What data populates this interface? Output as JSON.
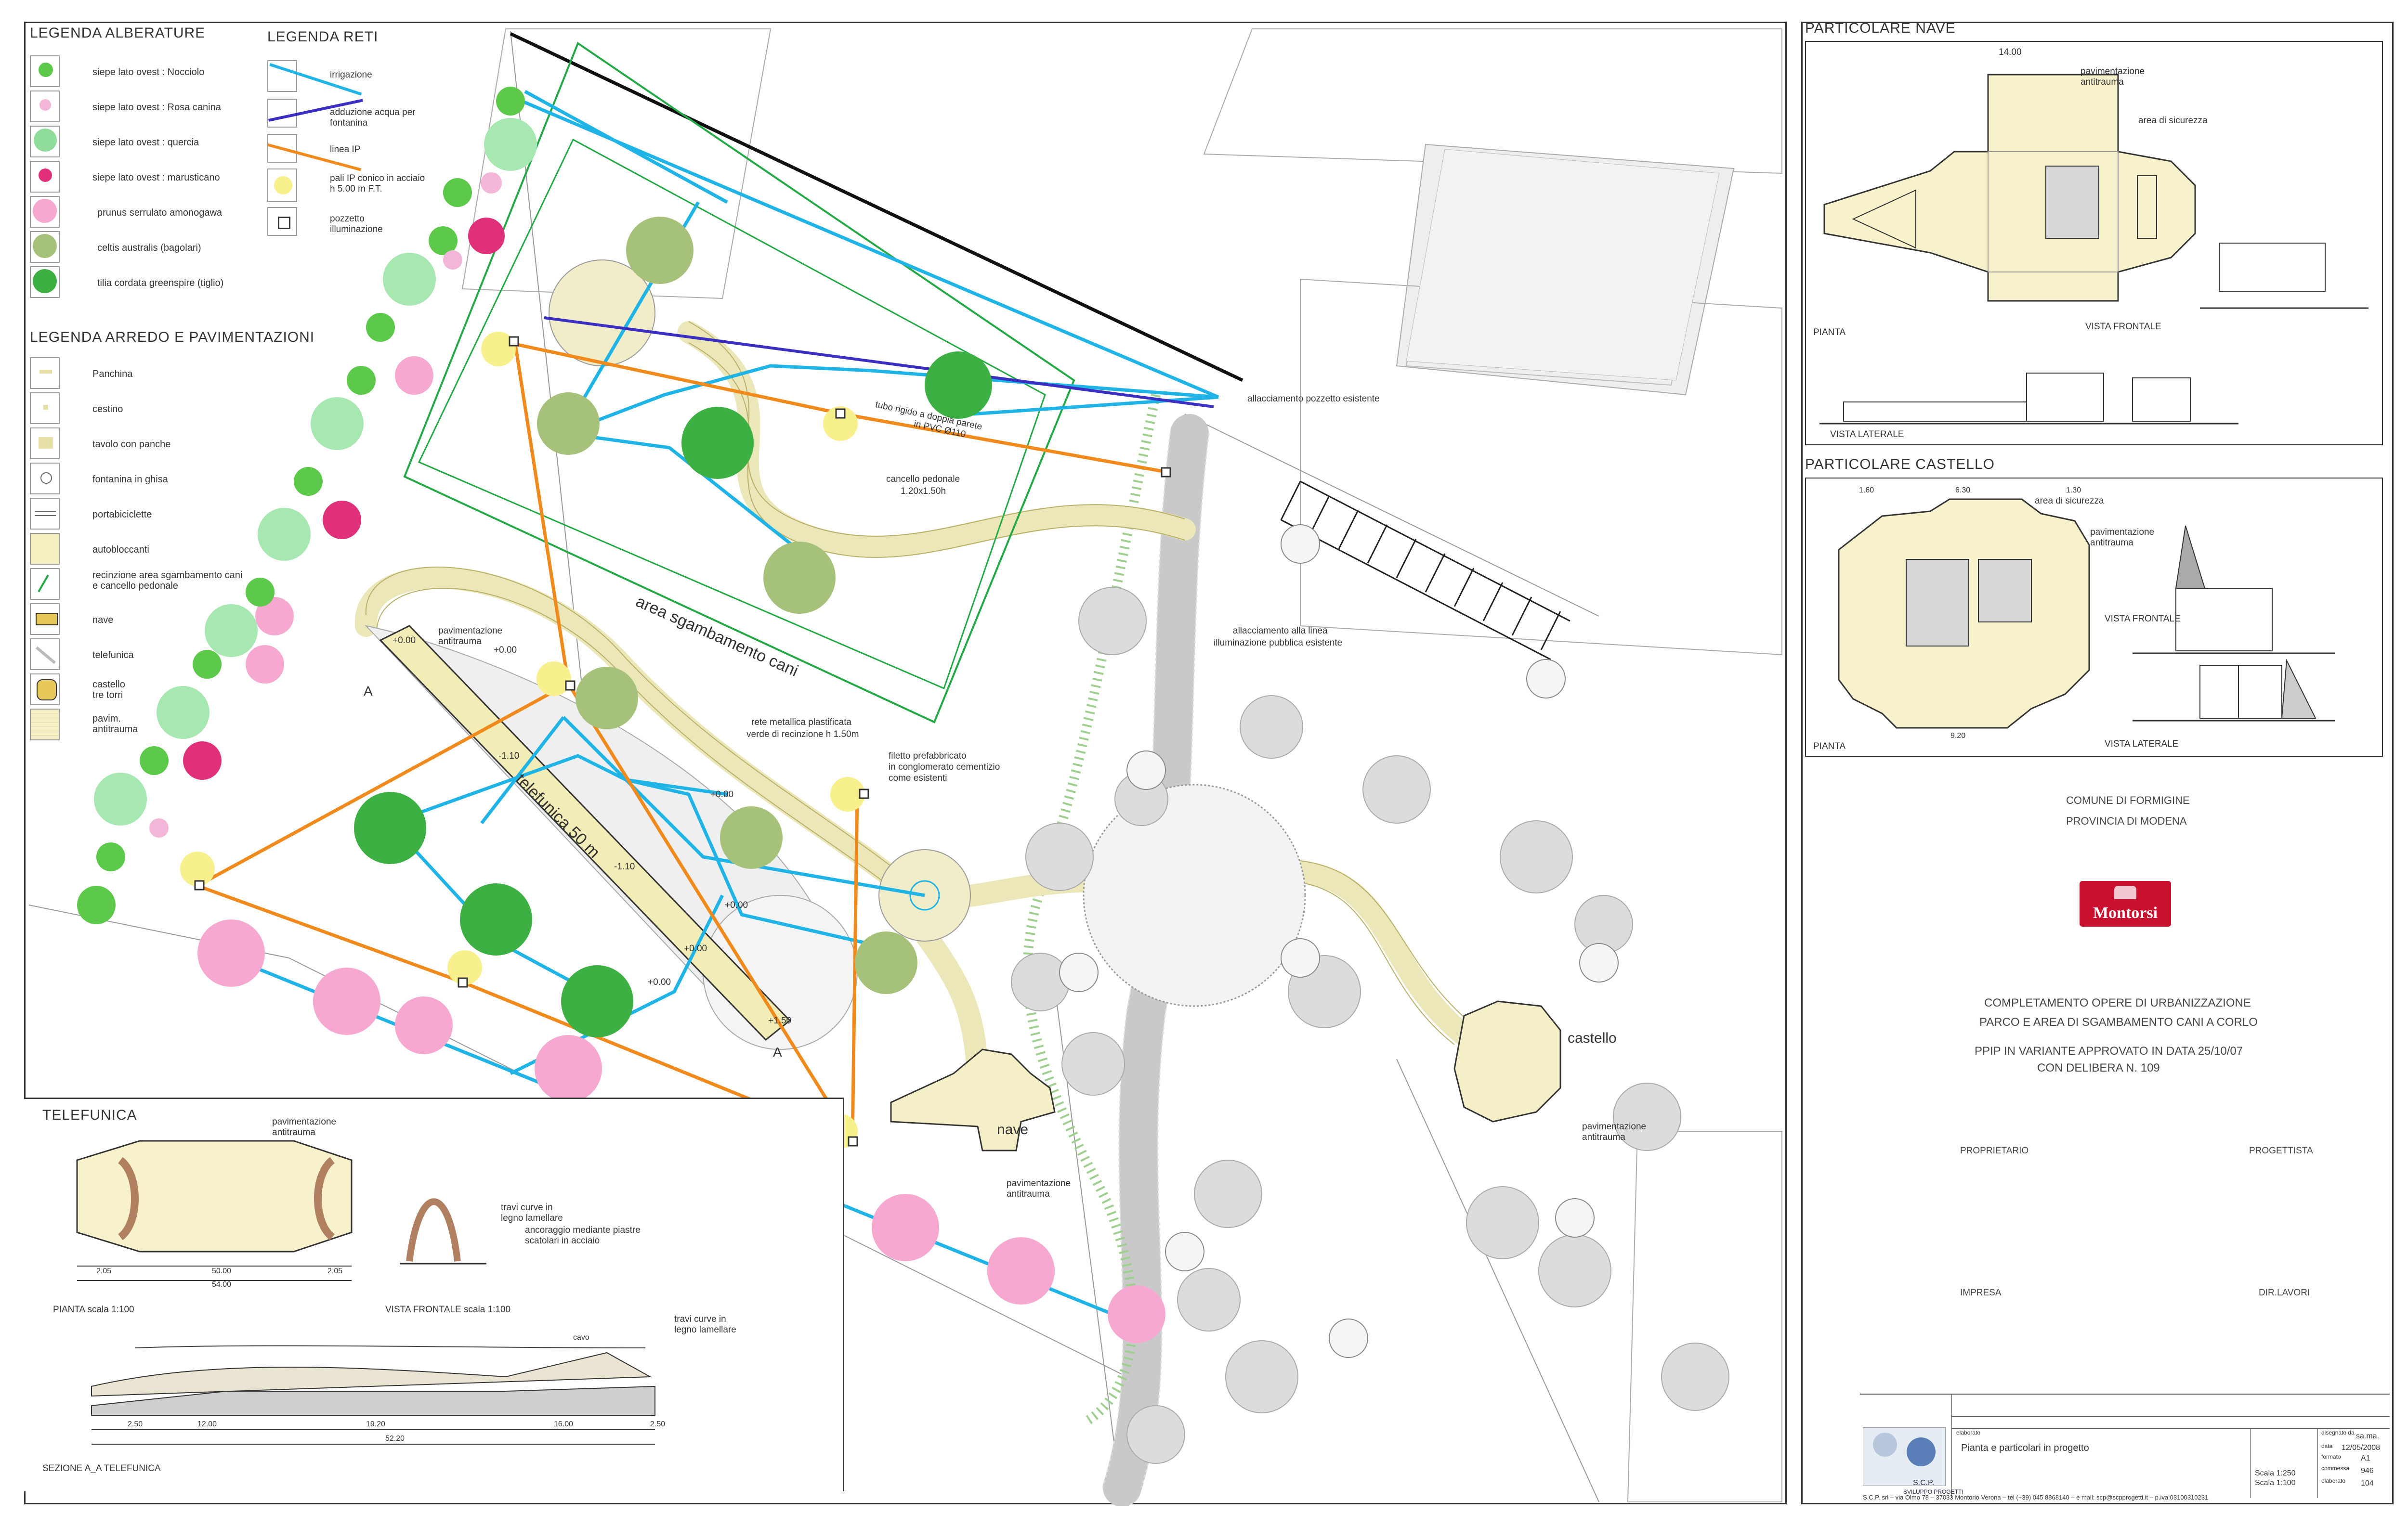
{
  "legend_alberature": {
    "title": "LEGENDA ALBERATURE",
    "items": [
      {
        "label": "siepe lato ovest : Nocciolo",
        "color": "#5cc94a"
      },
      {
        "label": "siepe lato ovest : Rosa canina",
        "color": "#f4b6d8"
      },
      {
        "label": "siepe lato ovest : quercia",
        "color": "#8fdc9a"
      },
      {
        "label": "siepe lato ovest : marusticano",
        "color": "#e0307a"
      },
      {
        "label": "prunus serrulato amonogawa",
        "color": "#f7a8d0"
      },
      {
        "label": "celtis australis (bagolari)",
        "color": "#a6c27a"
      },
      {
        "label": "tilia cordata greenspire (tiglio)",
        "color": "#3cb043"
      }
    ]
  },
  "legend_reti": {
    "title": "LEGENDA RETI",
    "items": [
      {
        "label": "irrigazione",
        "color": "#1fb3e6"
      },
      {
        "label": "adduzione acqua per fontanina",
        "color": "#3a2fc0"
      },
      {
        "label": "linea IP",
        "color": "#f08a1c"
      },
      {
        "label": "pali IP conico in acciaio h 5.00 m F.T.",
        "color": "#f5ef8a"
      },
      {
        "label": "pozzetto illuminazione",
        "color": "#333333"
      }
    ]
  },
  "legend_arredo": {
    "title": "LEGENDA ARREDO E PAVIMENTAZIONI",
    "items": [
      {
        "label": "Panchina"
      },
      {
        "label": "cestino"
      },
      {
        "label": "tavolo con panche"
      },
      {
        "label": "fontanina in ghisa"
      },
      {
        "label": "portabiciclette"
      },
      {
        "label": "autobloccanti"
      },
      {
        "label": "recinzione area sgambamento cani e cancello pedonale"
      },
      {
        "label": "nave"
      },
      {
        "label": "telefunica"
      },
      {
        "label": "castello tre torri"
      },
      {
        "label": "pavim. antitrauma"
      }
    ]
  },
  "plan_labels": {
    "area_cani": "area sgambamento cani",
    "telefunica": "telefunica 50 m",
    "castello": "castello",
    "nave": "nave",
    "section_a1": "A",
    "section_a2": "A",
    "allacciamento_pozzetto": "allacciamento pozzetto esistente",
    "tubo_rigido": "tubo rigido a doppia parete",
    "tubo_pvc": "in PVC Ø110",
    "cancello_1": "cancello pedonale",
    "cancello_2": "1.20x1.50h",
    "allacciamento_linea_1": "allacciamento alla linea",
    "allacciamento_linea_2": "illuminazione pubblica esistente",
    "rete_1": "rete metallica plastificata",
    "rete_2": "verde di recinzione h 1.50m",
    "filetto_1": "filetto prefabbricato",
    "filetto_2": "in conglomerato cementizio",
    "filetto_3": "come esistenti",
    "pav_antitrauma_1": "pavimentazione",
    "pav_antitrauma_2": "antitrauma",
    "elev_1": "+0.00",
    "elev_2": "+0.00",
    "elev_3": "-1.10",
    "elev_4": "-1.10",
    "elev_5": "+0.00",
    "elev_6": "+0.00",
    "elev_7": "+0.00",
    "elev_8": "+0.00",
    "elev_9": "+1.50"
  },
  "telefunica_detail": {
    "title": "TELEFUNICA",
    "pav_1": "pavimentazione",
    "pav_2": "antitrauma",
    "travi_1": "travi curve in",
    "travi_2": "legno lamellare",
    "ancor_1": "ancoraggio mediante piastre",
    "ancor_2": "scatolari in acciaio",
    "pianta": "PIANTA scala 1:100",
    "vista_frontale": "VISTA FRONTALE scala 1:100",
    "sezione": "SEZIONE A_A TELEFUNICA",
    "cavo": "cavo",
    "dim_total": "54.00",
    "dim_mid": "50.00",
    "dim_left": "2.05",
    "dim_right": "2.05",
    "sec_dims": [
      "2.50",
      "12.00",
      "19.20",
      "16.00",
      "2.50"
    ],
    "sec_total": "52.20"
  },
  "particolare_nave": {
    "title": "PARTICOLARE NAVE",
    "pav_1": "pavimentazione",
    "pav_2": "antitrauma",
    "area_sicurezza": "area di sicurezza",
    "pianta": "PIANTA",
    "vista_frontale": "VISTA FRONTALE",
    "vista_laterale": "VISTA LATERALE",
    "dim_top": "14.00"
  },
  "particolare_castello": {
    "title": "PARTICOLARE CASTELLO",
    "pav_1": "pavimentazione",
    "pav_2": "antitrauma",
    "area_sicurezza": "area di sicurezza",
    "pianta": "PIANTA",
    "vista_frontale": "VISTA FRONTALE",
    "vista_laterale": "VISTA LATERALE",
    "dims": [
      "1.60",
      "6.30",
      "1.30"
    ],
    "dim_bottom": "9.20"
  },
  "title_block": {
    "comune": "COMUNE DI FORMIGINE",
    "provincia": "PROVINCIA DI MODENA",
    "logo": "Montorsi",
    "project_1": "COMPLETAMENTO OPERE DI URBANIZZAZIONE",
    "project_2": "PARCO E AREA DI SGAMBAMENTO CANI A CORLO",
    "ppip_1": "PPIP IN VARIANTE APPROVATO IN DATA 25/10/07",
    "ppip_2": "CON DELIBERA N. 109",
    "proprietario": "PROPRIETARIO",
    "progettista": "PROGETTISTA",
    "impresa": "IMPRESA",
    "dir_lavori": "DIR.LAVORI",
    "elaborato_label": "elaborato",
    "elaborato": "Pianta e particolari in progetto",
    "disegno_label": "disegnato da",
    "disegno": "sa.ma.",
    "data_label": "data",
    "data": "12/05/2008",
    "formato_label": "formato",
    "formato": "A1",
    "commessa_label": "commessa",
    "commessa": "946",
    "elab_n_label": "elaborato",
    "elab_n": "104",
    "scala_1": "Scala 1:250",
    "scala_2": "Scala 1:100",
    "studio": "S.C.P.",
    "studio_sub": "SVILUPPO PROGETTI",
    "footer": "S.C.P. srl – via Olmo 78 – 37033 Montorio Verona –   tel (+39) 045 8868140   –   e mail: scp@scpprogetti.it   –   p.iva  03100310231"
  },
  "colors": {
    "irrigation": "#1fb3e6",
    "water": "#3a2fc0",
    "ip_line": "#f08a1c",
    "fence": "#22a844",
    "path_fill": "#f4f0c2",
    "pole_glow": "#f7f08c"
  }
}
